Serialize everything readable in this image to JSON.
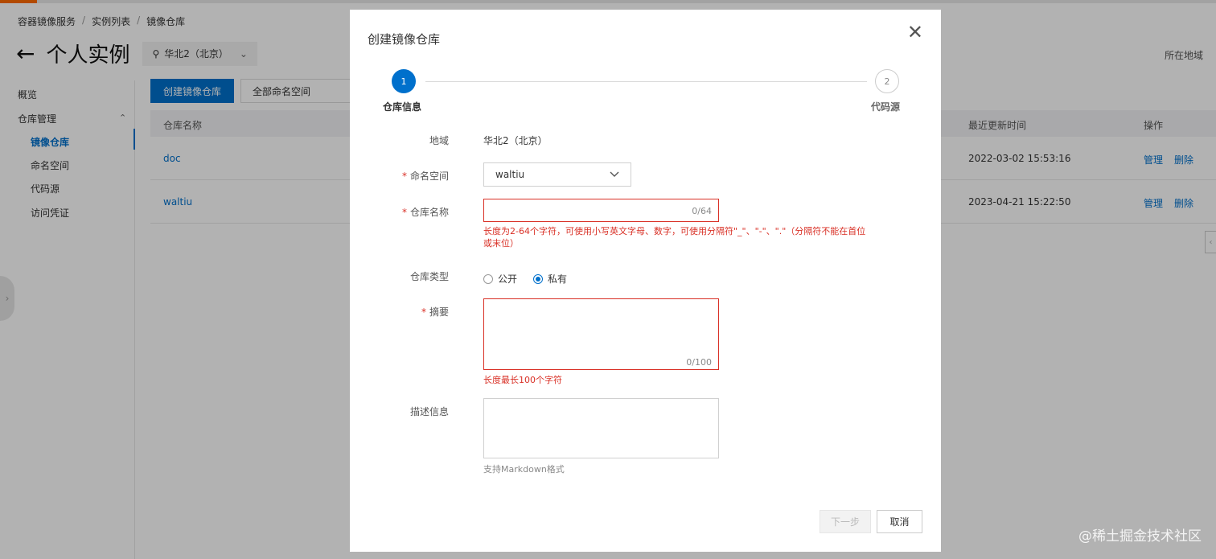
{
  "breadcrumb": [
    "容器镜像服务",
    "实例列表",
    "镜像仓库"
  ],
  "page": {
    "title": "个人实例",
    "region": "华北2（北京）",
    "region_label_right": "所在地域"
  },
  "sidebar": {
    "items": [
      {
        "label": "概览"
      },
      {
        "label": "仓库管理"
      },
      {
        "label": "镜像仓库",
        "active": true
      },
      {
        "label": "命名空间"
      },
      {
        "label": "代码源"
      },
      {
        "label": "访问凭证"
      }
    ]
  },
  "toolbar": {
    "create_label": "创建镜像仓库",
    "namespace_select": "全部命名空间"
  },
  "table": {
    "headers": [
      "仓库名称",
      "最近更新时间",
      "操作"
    ],
    "rows": [
      {
        "name": "doc",
        "updated": "2022-03-02 15:53:16",
        "manage": "管理",
        "delete": "删除"
      },
      {
        "name": "waltiu",
        "updated": "2023-04-21 15:22:50",
        "manage": "管理",
        "delete": "删除"
      }
    ]
  },
  "modal": {
    "title": "创建镜像仓库",
    "steps": [
      {
        "number": "1",
        "label": "仓库信息",
        "active": true
      },
      {
        "number": "2",
        "label": "代码源",
        "active": false
      }
    ],
    "form": {
      "region_label": "地域",
      "region_value": "华北2（北京）",
      "namespace_label": "命名空间",
      "namespace_value": "waltiu",
      "repo_name_label": "仓库名称",
      "repo_name_value": "",
      "repo_name_counter": "0/64",
      "repo_name_error": "长度为2-64个字符，可使用小写英文字母、数字，可使用分隔符\"_\"、\"-\"、\".\"（分隔符不能在首位或末位）",
      "repo_type_label": "仓库类型",
      "repo_type_options": [
        "公开",
        "私有"
      ],
      "repo_type_selected": "私有",
      "summary_label": "摘要",
      "summary_value": "",
      "summary_counter": "0/100",
      "summary_error": "长度最长100个字符",
      "description_label": "描述信息",
      "description_value": "",
      "description_hint": "支持Markdown格式"
    },
    "buttons": {
      "next": "下一步",
      "cancel": "取消"
    }
  },
  "watermark": "@稀土掘金技术社区",
  "colors": {
    "primary": "#0070cc",
    "error": "#d93026",
    "accent": "#ff6a00"
  }
}
